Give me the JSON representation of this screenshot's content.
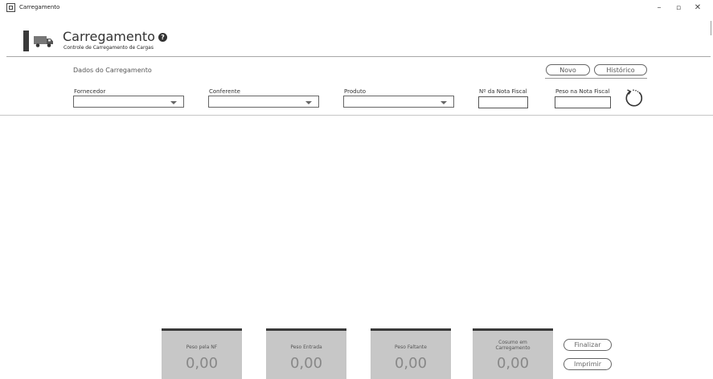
{
  "window": {
    "title": "Carregamento",
    "minimize": "–",
    "maximize": "▫",
    "close": "✕"
  },
  "header": {
    "title": "Carregamento",
    "subtitle": "Controle de Carregamento de Cargas",
    "help_icon": "?"
  },
  "section": {
    "label": "Dados do Carregamento",
    "buttons": {
      "novo": "Novo",
      "historico": "Histórico"
    }
  },
  "fields": {
    "fornecedor": {
      "label": "Fornecedor",
      "value": ""
    },
    "conferente": {
      "label": "Conferente",
      "value": ""
    },
    "produto": {
      "label": "Produto",
      "value": ""
    },
    "nota_fiscal": {
      "label": "Nº da Nota Fiscal",
      "value": ""
    },
    "peso_nota": {
      "label": "Peso na Nota Fiscal",
      "value": ""
    }
  },
  "panels": [
    {
      "label": "Peso pela NF",
      "value": "0,00"
    },
    {
      "label": "Peso Entrada",
      "value": "0,00"
    },
    {
      "label": "Peso Faltante",
      "value": "0,00"
    },
    {
      "label": "Cosumo em Carregamento",
      "value": "0,00"
    }
  ],
  "actions": {
    "finalizar": "Finalizar",
    "imprimir": "Imprimir"
  },
  "icons": {
    "app": "app-icon",
    "truck": "truck-icon",
    "help": "help-icon",
    "refresh": "refresh-icon",
    "dropdown": "chevron-down-icon"
  },
  "colors": {
    "accent": "#3a3a3a",
    "panel": "#c7c7c7",
    "panel_value": "#888888"
  }
}
